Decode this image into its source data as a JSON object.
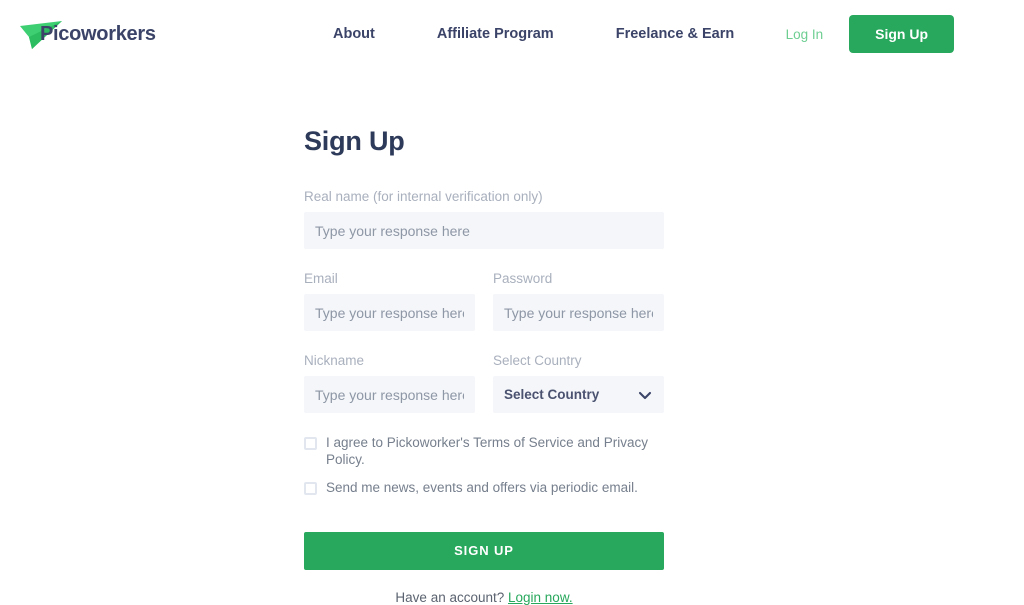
{
  "brand": {
    "name": "Picoworkers",
    "logo_icon": "paper-plane-icon",
    "accent_green": "#27a85c",
    "navy": "#3b4468"
  },
  "header": {
    "nav_items": [
      {
        "label": "About"
      },
      {
        "label": "Affiliate Program"
      },
      {
        "label": "Freelance & Earn"
      }
    ],
    "login_label": "Log In",
    "signup_label": "Sign Up"
  },
  "main": {
    "title": "Sign Up",
    "placeholder": "Type your response here",
    "fields": {
      "real_name": {
        "label": "Real name (for internal verification only)",
        "value": "",
        "placeholder": "Type your response here"
      },
      "email": {
        "label": "Email",
        "value": "",
        "placeholder": "Type your response here"
      },
      "password": {
        "label": "Password",
        "value": "",
        "placeholder": "Type your response here"
      },
      "nickname": {
        "label": "Nickname",
        "value": "",
        "placeholder": "Type your response here"
      },
      "country": {
        "label": "Select Country",
        "selected": "Select Country",
        "chevron_icon": "chevron-down-icon"
      }
    },
    "checkboxes": [
      {
        "label": "I agree to Pickoworker's Terms of Service and Privacy Policy.",
        "checked": false
      },
      {
        "label": "Send me news, events and offers via periodic email.",
        "checked": false
      }
    ],
    "submit_label": "SIGN UP",
    "footer": {
      "text": "Have an account?",
      "link_label": "Login now."
    }
  }
}
